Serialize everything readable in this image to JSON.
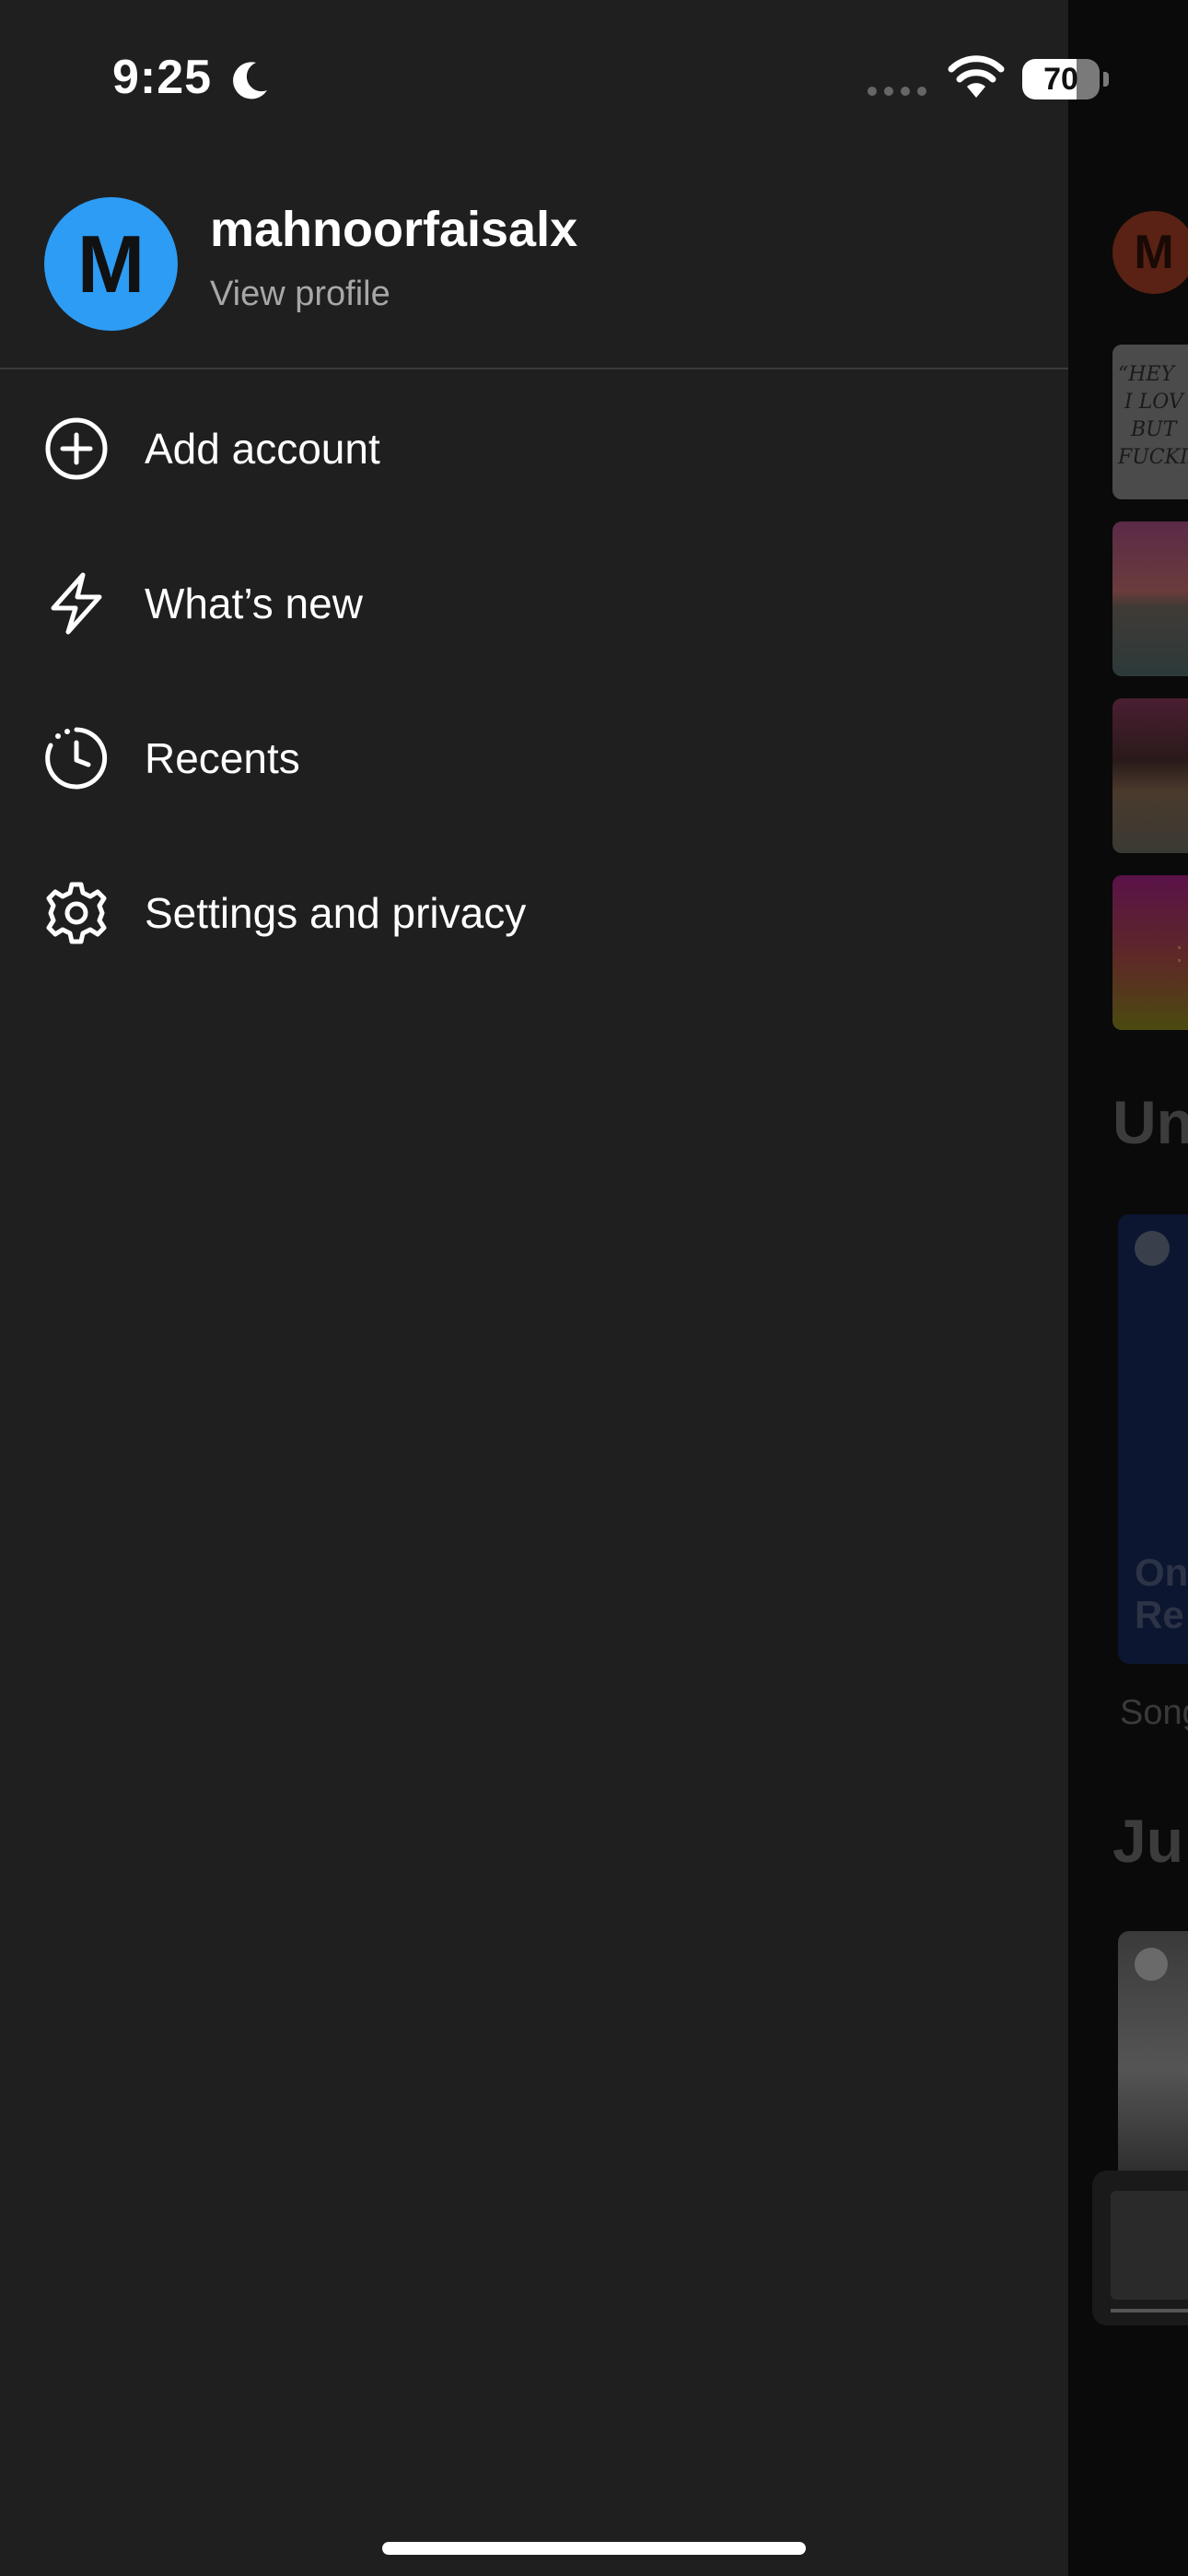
{
  "status_bar": {
    "time": "9:25",
    "battery_text": "70",
    "battery_level": 0.7,
    "icons": [
      "moon-icon",
      "signal-icon",
      "wifi-icon",
      "battery-icon"
    ]
  },
  "profile": {
    "avatar_initial": "M",
    "avatar_color": "#2d9cf5",
    "name": "mahnoorfaisalx",
    "view_profile": "View profile"
  },
  "menu": {
    "items": [
      {
        "label": "Add account",
        "icon": "plus-circle-icon"
      },
      {
        "label": "What’s new",
        "icon": "lightning-icon"
      },
      {
        "label": "Recents",
        "icon": "history-clock-icon"
      },
      {
        "label": "Settings and privacy",
        "icon": "gear-icon"
      }
    ]
  },
  "background_app": {
    "avatar_initial": "M",
    "tile_scrawl": "“HEY\n I LOV\n  BUT\nFUCKIN",
    "section_heading_1": "Un",
    "card_text": "On\nRe",
    "card_caption": "Song",
    "section_heading_2": "Ju"
  },
  "colors": {
    "drawer_bg": "#1f1f1f",
    "accent_avatar": "#2d9cf5",
    "text_primary": "#ffffff",
    "text_secondary": "#a7a7a7"
  }
}
